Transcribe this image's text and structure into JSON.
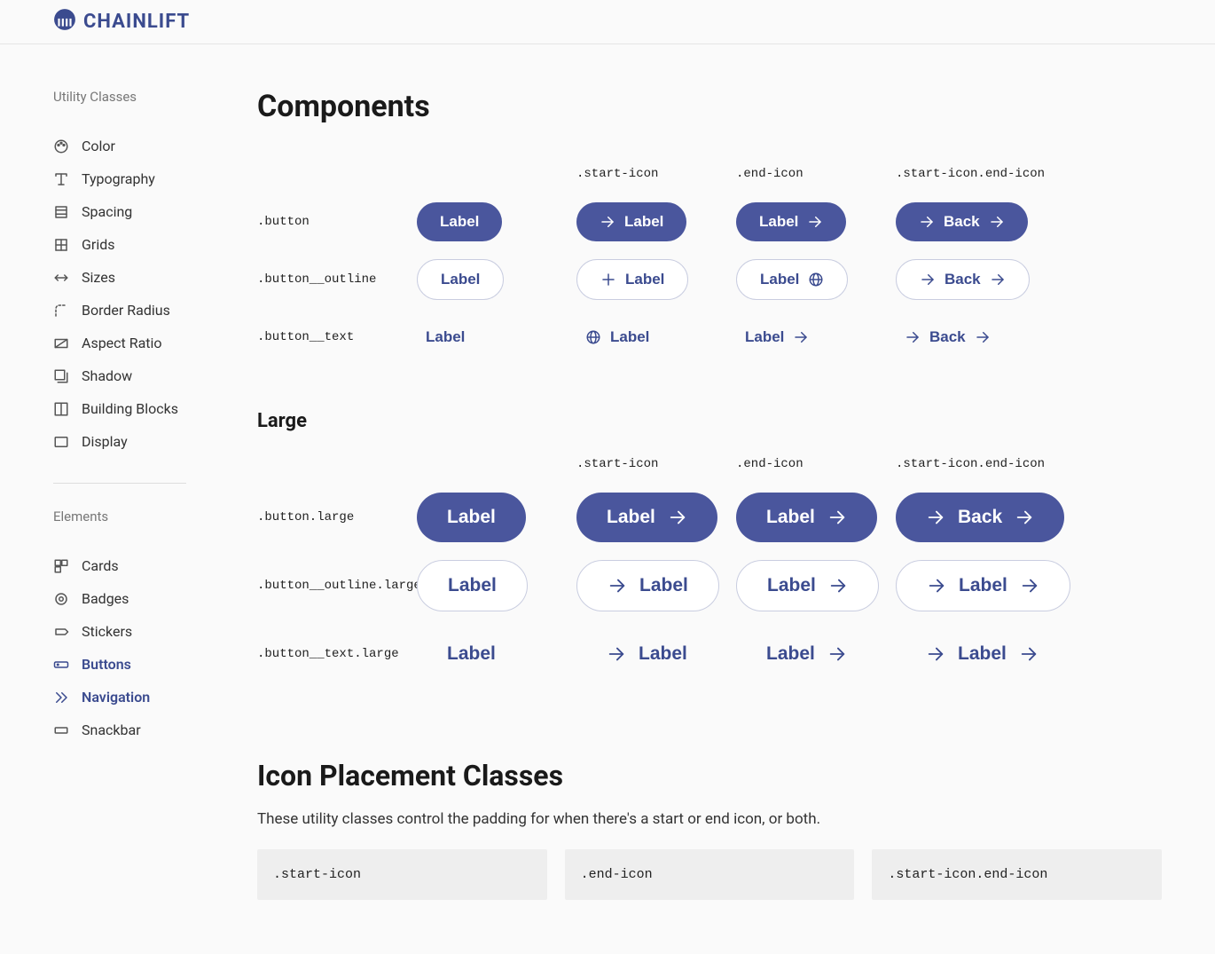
{
  "brand": "CHAINLIFT",
  "sidebar": {
    "section1_title": "Utility Classes",
    "section1_items": [
      {
        "label": "Color"
      },
      {
        "label": "Typography"
      },
      {
        "label": "Spacing"
      },
      {
        "label": "Grids"
      },
      {
        "label": "Sizes"
      },
      {
        "label": "Border Radius"
      },
      {
        "label": "Aspect Ratio"
      },
      {
        "label": "Shadow"
      },
      {
        "label": "Building Blocks"
      },
      {
        "label": "Display"
      }
    ],
    "section2_title": "Elements",
    "section2_items": [
      {
        "label": "Cards"
      },
      {
        "label": "Badges"
      },
      {
        "label": "Stickers"
      },
      {
        "label": "Buttons"
      },
      {
        "label": "Navigation"
      },
      {
        "label": "Snackbar"
      }
    ]
  },
  "page": {
    "title": "Components",
    "col_headers": [
      "",
      ".start-icon",
      ".end-icon",
      ".start-icon.end-icon"
    ],
    "rows": [
      {
        "label": ".button",
        "cells": [
          "Label",
          "Label",
          "Label",
          "Back"
        ]
      },
      {
        "label": ".button__outline",
        "cells": [
          "Label",
          "Label",
          "Label",
          "Back"
        ]
      },
      {
        "label": ".button__text",
        "cells": [
          "Label",
          "Label",
          "Label",
          "Back"
        ]
      }
    ],
    "large_title": "Large",
    "large_rows": [
      {
        "label": ".button.large",
        "cells": [
          "Label",
          "Label",
          "Label",
          "Back"
        ]
      },
      {
        "label": ".button__outline.large",
        "cells": [
          "Label",
          "Label",
          "Label",
          "Label"
        ]
      },
      {
        "label": ".button__text.large",
        "cells": [
          "Label",
          "Label",
          "Label",
          "Label"
        ]
      }
    ],
    "icon_section_title": "Icon Placement Classes",
    "icon_section_desc": "These utility classes control the padding for when there's a start or end icon, or both.",
    "code_chips": [
      ".start-icon",
      ".end-icon",
      ".start-icon.end-icon"
    ]
  }
}
